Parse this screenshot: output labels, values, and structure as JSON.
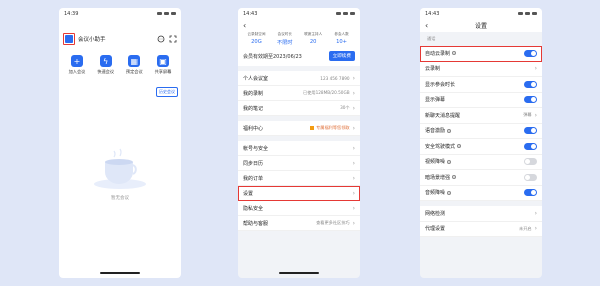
{
  "phone1": {
    "time": "14:39",
    "app_name": "会议小助手",
    "quick_actions": [
      {
        "label": "加入会议",
        "icon": "plus-icon"
      },
      {
        "label": "快速会议",
        "icon": "lightning-icon"
      },
      {
        "label": "预定会议",
        "icon": "calendar-icon"
      },
      {
        "label": "共享屏幕",
        "icon": "screen-share-icon"
      }
    ],
    "history_link": "历史会议",
    "empty_text": "暂无会议"
  },
  "phone2": {
    "time": "14:43",
    "stats": [
      {
        "label": "云录制空间",
        "value": "20G"
      },
      {
        "label": "会议时长",
        "value": "不限时"
      },
      {
        "label": "联席主持人",
        "value": "20"
      },
      {
        "label": "参会人数",
        "value": "10+"
      }
    ],
    "member_text": "会员有效期至2023/06/23",
    "renew_label": "立即续费",
    "rows": [
      {
        "label": "个人会议室",
        "value": "123 456 7890",
        "name": "row-personal-room"
      },
      {
        "label": "我的录制",
        "value": "已使用128MB/20.50GB",
        "name": "row-my-recordings"
      },
      {
        "label": "我的笔记",
        "value": "30个",
        "name": "row-my-notes"
      },
      {
        "label": "福利中心",
        "value": "专属福利等您领取",
        "name": "row-benefits"
      },
      {
        "label": "帐号与安全",
        "value": "",
        "name": "row-account-security"
      },
      {
        "label": "同步日历",
        "value": "",
        "name": "row-sync-calendar"
      },
      {
        "label": "我的订单",
        "value": "",
        "name": "row-my-orders"
      },
      {
        "label": "设置",
        "value": "",
        "name": "row-settings"
      },
      {
        "label": "隐私安全",
        "value": "",
        "name": "row-privacy"
      },
      {
        "label": "帮助与客服",
        "value": "查看更多社区技巧",
        "name": "row-help"
      }
    ]
  },
  "phone3": {
    "time": "14:43",
    "title": "设置",
    "section": "通话",
    "items": [
      {
        "label": "自动云录制",
        "toggle": true,
        "info": true
      },
      {
        "label": "云录制",
        "toggle": null,
        "info": false
      },
      {
        "label": "显示参会时长",
        "toggle": true,
        "info": false
      },
      {
        "label": "显示弹幕",
        "toggle": true,
        "info": false
      },
      {
        "label": "新聊天消息提醒",
        "toggle": null,
        "value": "弹幕",
        "info": false
      },
      {
        "label": "语音激励",
        "toggle": true,
        "info": true
      },
      {
        "label": "安全驾驶模式",
        "toggle": true,
        "info": true
      },
      {
        "label": "视频降噪",
        "toggle": false,
        "info": true
      },
      {
        "label": "暗场景增强",
        "toggle": false,
        "info": true
      },
      {
        "label": "音频降噪",
        "toggle": true,
        "info": true
      },
      {
        "label": "网络检测",
        "toggle": null,
        "info": false
      },
      {
        "label": "代理设置",
        "toggle": null,
        "value": "未开启",
        "info": false
      }
    ]
  },
  "colors": {
    "accent": "#2a6cf0",
    "highlight": "#e53935"
  }
}
